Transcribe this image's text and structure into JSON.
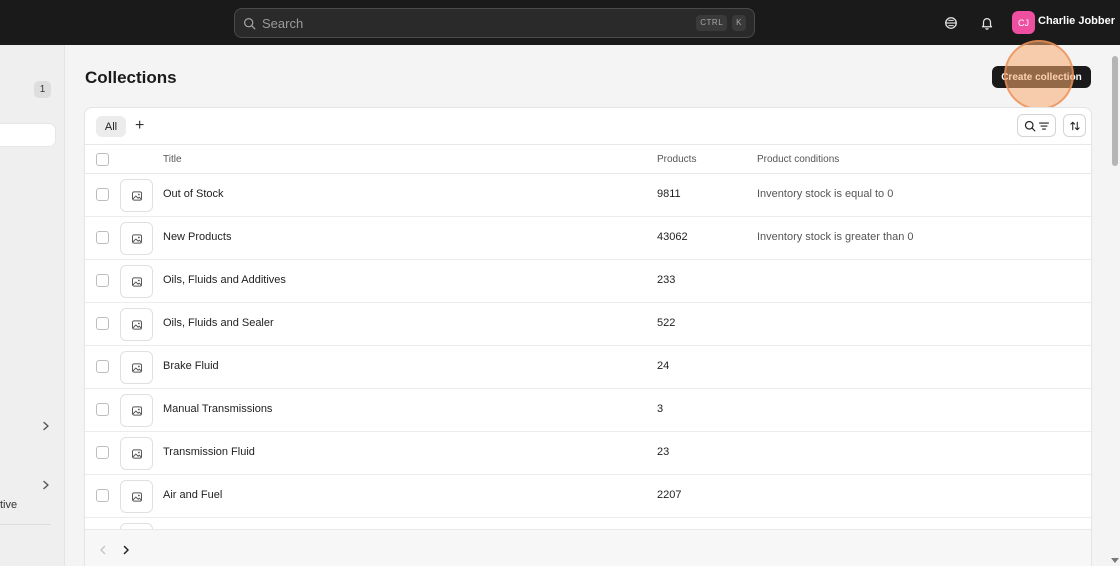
{
  "topbar": {
    "search_placeholder": "Search",
    "shortcut_ctrl": "CTRL",
    "shortcut_key": "K",
    "user_initials": "CJ",
    "user_name": "Charlie Jobber"
  },
  "sidebar": {
    "badge_count": "1",
    "partial_label": "tive"
  },
  "page": {
    "title": "Collections",
    "create_button": "Create collection"
  },
  "tabs": {
    "all_label": "All",
    "add_label": "+"
  },
  "table": {
    "columns": [
      "Title",
      "Products",
      "Product conditions"
    ],
    "rows": [
      {
        "title": "Out of Stock",
        "products": "9811",
        "conditions": "Inventory stock is equal to 0"
      },
      {
        "title": "New Products",
        "products": "43062",
        "conditions": "Inventory stock is greater than 0"
      },
      {
        "title": "Oils, Fluids and Additives",
        "products": "233",
        "conditions": ""
      },
      {
        "title": "Oils, Fluids and Sealer",
        "products": "522",
        "conditions": ""
      },
      {
        "title": "Brake Fluid",
        "products": "24",
        "conditions": ""
      },
      {
        "title": "Manual Transmissions",
        "products": "3",
        "conditions": ""
      },
      {
        "title": "Transmission Fluid",
        "products": "23",
        "conditions": ""
      },
      {
        "title": "Air and Fuel",
        "products": "2207",
        "conditions": ""
      }
    ]
  },
  "colors": {
    "topbar_bg": "#1a1a1a",
    "accent_avatar": "#ee4fa0",
    "primary_button": "#1a1a1a",
    "highlight_ring": "#f7ab70"
  },
  "icons": {
    "search": "search-icon",
    "notifications": "bell-icon",
    "help": "support-icon",
    "filter": "filter-icon",
    "sort": "sort-icon",
    "thumbnail": "image-placeholder-icon",
    "pagination_prev": "chevron-left-icon",
    "pagination_next": "chevron-right-icon"
  }
}
